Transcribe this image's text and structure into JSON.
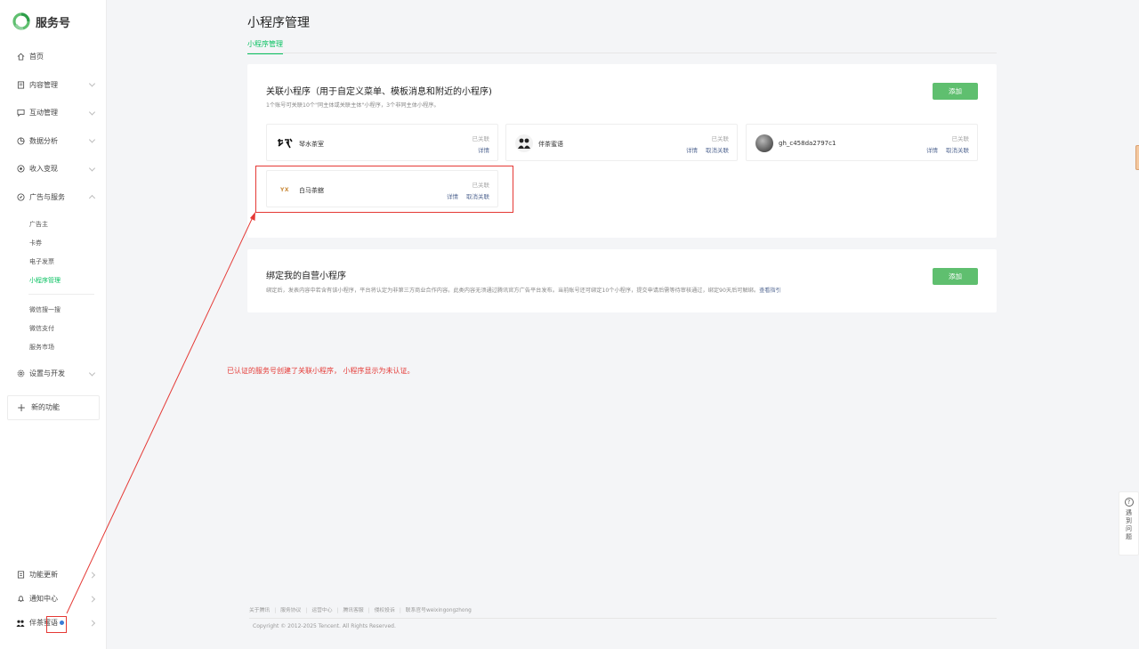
{
  "app": {
    "title": "服务号"
  },
  "sidebar": {
    "items": [
      {
        "label": "首页",
        "icon": "home-icon"
      },
      {
        "label": "内容管理",
        "icon": "document-icon",
        "chevron": "down"
      },
      {
        "label": "互动管理",
        "icon": "chat-icon",
        "chevron": "down"
      },
      {
        "label": "数据分析",
        "icon": "pie-chart-icon",
        "chevron": "down"
      },
      {
        "label": "收入变现",
        "icon": "coin-icon",
        "chevron": "down"
      },
      {
        "label": "广告与服务",
        "icon": "compass-icon",
        "chevron": "up"
      }
    ],
    "sub_items_a": [
      "广告主",
      "卡券",
      "电子发票",
      "小程序管理"
    ],
    "sub_items_b": [
      "微信搜一搜",
      "微信支付",
      "服务市场"
    ],
    "settings": {
      "label": "设置与开发",
      "icon": "gear-icon"
    },
    "new_feature": "新的功能",
    "bottom": [
      {
        "label": "功能更新",
        "icon": "update-icon"
      },
      {
        "label": "通知中心",
        "icon": "bell-icon"
      },
      {
        "label": "伴茶蜜语",
        "icon": "account-avatar-icon"
      }
    ]
  },
  "main": {
    "title": "小程序管理",
    "tab": "小程序管理",
    "linked": {
      "title": "关联小程序（用于自定义菜单、模板消息和附近的小程序)",
      "subtitle": "1个账号可关联10个\"同主体或关联主体\"小程序，3个非同主体小程序。",
      "add_label": "添加",
      "mini_programs": [
        {
          "name": "琴水茶室",
          "status": "已关联",
          "actions": [
            "详情"
          ],
          "avatar": "calligraphy-logo-icon"
        },
        {
          "name": "伴茶蜜语",
          "status": "已关联",
          "actions": [
            "详情",
            "取消关联"
          ],
          "avatar": "two-people-logo-icon"
        },
        {
          "name": "gh_c458da2797c1",
          "status": "已关联",
          "actions": [
            "详情",
            "取消关联"
          ],
          "avatar": "photo-avatar-icon"
        },
        {
          "name": "白马茶舘",
          "status": "已关联",
          "actions": [
            "详情",
            "取消关联"
          ],
          "avatar": "yx-logo-icon"
        }
      ]
    },
    "self_operated": {
      "title": "绑定我的自营小程序",
      "subtitle": "绑定后，发表内容中若含有该小程序，平台将认定为非第三方商业合作内容。此类内容无须通过腾讯官方广告平台发布。当前账号还可绑定10个小程序，提交申请后需等待审核通过，绑定90天后可解绑。",
      "guide_link": "查看指引",
      "add_label": "添加"
    }
  },
  "annotation": "已认证的服务号创建了关联小程序， 小程序显示为未认证。",
  "footer": {
    "links": [
      "关于腾讯",
      "服务协议",
      "运营中心",
      "腾讯客服",
      "侵权投诉",
      "联系官号weixingongzhong"
    ],
    "copyright": "Copyright © 2012-2025 Tencent. All Rights Reserved."
  },
  "help": {
    "label": "遇到问题"
  },
  "colors": {
    "accent": "#07c160",
    "button": "#5fbf6f",
    "link": "#576b95",
    "annotation": "#e53935"
  }
}
